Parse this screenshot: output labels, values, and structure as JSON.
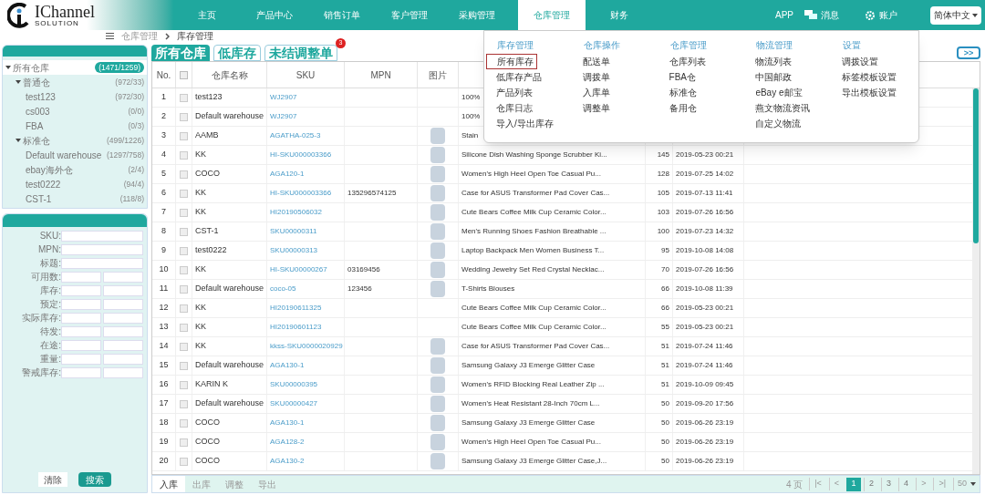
{
  "logo": {
    "title": "IChannel",
    "subtitle": "SOLUTION"
  },
  "nav": {
    "items": [
      {
        "label": "主页",
        "selected": false
      },
      {
        "label": "产品中心",
        "selected": false
      },
      {
        "label": "销售订单",
        "selected": false
      },
      {
        "label": "客户管理",
        "selected": false
      },
      {
        "label": "采购管理",
        "selected": false
      },
      {
        "label": "仓库管理",
        "selected": true
      },
      {
        "label": "财务",
        "selected": false
      }
    ],
    "app": "APP",
    "messages": "消息",
    "account": "账户",
    "language": "简体中文"
  },
  "mega_menu": [
    {
      "heading": "库存管理",
      "items": [
        {
          "label": "所有库存",
          "selected": true
        },
        {
          "label": "低库存产品",
          "selected": false
        },
        {
          "label": "产品列表",
          "selected": false
        },
        {
          "label": "仓库日志",
          "selected": false
        },
        {
          "label": "导入/导出库存",
          "selected": false
        }
      ]
    },
    {
      "heading": "仓库操作",
      "items": [
        {
          "label": "配送单",
          "selected": false
        },
        {
          "label": "调拨单",
          "selected": false
        },
        {
          "label": "入库单",
          "selected": false
        },
        {
          "label": "调整单",
          "selected": false
        }
      ]
    },
    {
      "heading": "仓库管理",
      "items": [
        {
          "label": "仓库列表",
          "selected": false
        },
        {
          "label": "FBA仓",
          "selected": false
        },
        {
          "label": "标准仓",
          "selected": false
        },
        {
          "label": "备用仓",
          "selected": false
        }
      ]
    },
    {
      "heading": "物流管理",
      "items": [
        {
          "label": "物流列表",
          "selected": false
        },
        {
          "label": "中国邮政",
          "selected": false
        },
        {
          "label": "eBay e邮宝",
          "selected": false
        },
        {
          "label": "燕文物流资讯",
          "selected": false
        },
        {
          "label": "自定义物流",
          "selected": false
        }
      ]
    },
    {
      "heading": "设置",
      "items": [
        {
          "label": "调拨设置",
          "selected": false
        },
        {
          "label": "标签模板设置",
          "selected": false
        },
        {
          "label": "导出模板设置",
          "selected": false
        }
      ]
    }
  ],
  "breadcrumb": [
    "仓库管理",
    "库存管理"
  ],
  "tree": [
    {
      "label": "所有仓库",
      "count": "(1471/1259)",
      "selected": true,
      "expanded": true,
      "children": [
        {
          "label": "普通仓",
          "count": "(972/33)",
          "selected": false,
          "expanded": true,
          "children": [
            {
              "label": "test123",
              "count": "(972/30)",
              "selected": false
            },
            {
              "label": "cs003",
              "count": "(0/0)",
              "selected": false
            },
            {
              "label": "FBA",
              "count": "(0/3)",
              "selected": false
            }
          ]
        },
        {
          "label": "标准仓",
          "count": "(499/1226)",
          "selected": false,
          "expanded": true,
          "children": [
            {
              "label": "Default warehouse",
              "count": "(1297/758)",
              "selected": false
            },
            {
              "label": "ebay海外仓",
              "count": "(2/4)",
              "selected": false
            },
            {
              "label": "test0222",
              "count": "(94/4)",
              "selected": false
            },
            {
              "label": "CST-1",
              "count": "(118/8)",
              "selected": false
            }
          ]
        }
      ]
    }
  ],
  "filters": [
    {
      "label": "SKU:",
      "kind": "single"
    },
    {
      "label": "MPN:",
      "kind": "single"
    },
    {
      "label": "标题:",
      "kind": "single"
    },
    {
      "label": "可用数:",
      "kind": "range"
    },
    {
      "label": "库存:",
      "kind": "range"
    },
    {
      "label": "预定:",
      "kind": "range"
    },
    {
      "label": "实际库存:",
      "kind": "range"
    },
    {
      "label": "待发:",
      "kind": "range"
    },
    {
      "label": "在途:",
      "kind": "range"
    },
    {
      "label": "重量:",
      "kind": "range"
    },
    {
      "label": "警戒库存:",
      "kind": "range"
    }
  ],
  "filter_buttons": [
    "清除",
    "搜索"
  ],
  "tabs": [
    {
      "label": "所有仓库",
      "selected": true
    },
    {
      "label": "低库存",
      "selected": false
    },
    {
      "label": "未结调整单",
      "selected": false,
      "badge": "3"
    }
  ],
  "expand_button": ">>",
  "table": {
    "columns": [
      "No.",
      "仓库名称",
      "SKU",
      "MPN",
      "图片"
    ],
    "all_checked": false,
    "rows": [
      {
        "no": "1",
        "checked": false,
        "warehouse": "test123",
        "sku": "WJ2907",
        "mpn": "",
        "image": false,
        "title": "100%"
      },
      {
        "no": "2",
        "checked": false,
        "warehouse": "Default warehouse",
        "sku": "WJ2907",
        "mpn": "",
        "image": false,
        "title": "100%"
      },
      {
        "no": "3",
        "checked": false,
        "warehouse": "AAMB",
        "sku": "AGATHA-025-3",
        "mpn": "",
        "image": true,
        "title": "Stain"
      },
      {
        "no": "4",
        "checked": false,
        "warehouse": "KK",
        "sku": "HI-SKU000003366",
        "mpn": "",
        "image": true,
        "title": "Silicone Dish Washing Sponge Scrubber Ki...",
        "qty": "145",
        "date": "2019-05-23 00:21"
      },
      {
        "no": "5",
        "checked": false,
        "warehouse": "COCO",
        "sku": "AGA120-1",
        "mpn": "",
        "image": true,
        "title": "Women's High Heel Open Toe Casual Pu...",
        "qty": "128",
        "date": "2019-07-25 14:02"
      },
      {
        "no": "6",
        "checked": false,
        "warehouse": "KK",
        "sku": "HI-SKU000003366",
        "mpn": "135296574125",
        "image": true,
        "title": "Case for ASUS Transformer Pad Cover Cas...",
        "qty": "105",
        "date": "2019-07-13 11:41"
      },
      {
        "no": "7",
        "checked": false,
        "warehouse": "KK",
        "sku": "HI20190506032",
        "mpn": "",
        "image": true,
        "title": "Cute Bears Coffee Milk Cup Ceramic Color...",
        "qty": "103",
        "date": "2019-07-26 16:56"
      },
      {
        "no": "8",
        "checked": false,
        "warehouse": "CST-1",
        "sku": "SKU00000311",
        "mpn": "",
        "image": true,
        "title": "Men's Running Shoes Fashion Breathable ...",
        "qty": "100",
        "date": "2019-07-23 14:32"
      },
      {
        "no": "9",
        "checked": false,
        "warehouse": "test0222",
        "sku": "SKU00000313",
        "mpn": "",
        "image": true,
        "title": "Laptop Backpack Men Women Business T...",
        "qty": "95",
        "date": "2019-10-08 14:08"
      },
      {
        "no": "10",
        "checked": false,
        "warehouse": "KK",
        "sku": "HI-SKU00000267",
        "mpn": "03169456",
        "image": true,
        "title": "Wedding Jewelry Set Red Crystal Necklac...",
        "qty": "70",
        "date": "2019-07-26 16:56"
      },
      {
        "no": "11",
        "checked": false,
        "warehouse": "Default warehouse",
        "sku": "coco-05",
        "mpn": "123456",
        "image": true,
        "title": "T-Shirts Blouses",
        "qty": "66",
        "date": "2019-10-08 11:39"
      },
      {
        "no": "12",
        "checked": false,
        "warehouse": "KK",
        "sku": "HI20190611325",
        "mpn": "",
        "image": false,
        "title": "Cute Bears Coffee Milk Cup Ceramic Color...",
        "qty": "66",
        "date": "2019-05-23 00:21"
      },
      {
        "no": "13",
        "checked": false,
        "warehouse": "KK",
        "sku": "HI20190601123",
        "mpn": "",
        "image": false,
        "title": "Cute Bears Coffee Milk Cup Ceramic Color...",
        "qty": "55",
        "date": "2019-05-23 00:21"
      },
      {
        "no": "14",
        "checked": false,
        "warehouse": "KK",
        "sku": "kkss-SKU0000020929",
        "mpn": "",
        "image": true,
        "title": "Case for ASUS Transformer Pad Cover Cas...",
        "qty": "51",
        "date": "2019-07-24 11:46"
      },
      {
        "no": "15",
        "checked": false,
        "warehouse": "Default warehouse",
        "sku": "AGA130-1",
        "mpn": "",
        "image": true,
        "title": "Samsung Galaxy J3 Emerge Glitter Case",
        "qty": "51",
        "date": "2019-07-24 11:46"
      },
      {
        "no": "16",
        "checked": false,
        "warehouse": "KARIN K",
        "sku": "SKU00000395",
        "mpn": "",
        "image": true,
        "title": "Women's RFID Blocking Real Leather Zip ...",
        "qty": "51",
        "date": "2019-10-09 09:45"
      },
      {
        "no": "17",
        "checked": false,
        "warehouse": "Default warehouse",
        "sku": "SKU00000427",
        "mpn": "",
        "image": true,
        "title": "Women's Heat Resistant 28-Inch 70cm L...",
        "qty": "50",
        "date": "2019-09-20 17:56"
      },
      {
        "no": "18",
        "checked": false,
        "warehouse": "COCO",
        "sku": "AGA130-1",
        "mpn": "",
        "image": true,
        "title": "Samsung Galaxy J3 Emerge Glitter Case",
        "qty": "50",
        "date": "2019-06-26 23:19"
      },
      {
        "no": "19",
        "checked": false,
        "warehouse": "COCO",
        "sku": "AGA128-2",
        "mpn": "",
        "image": true,
        "title": "Women's High Heel Open Toe Casual Pu...",
        "qty": "50",
        "date": "2019-06-26 23:19"
      },
      {
        "no": "20",
        "checked": false,
        "warehouse": "COCO",
        "sku": "AGA130-2",
        "mpn": "",
        "image": true,
        "title": "Samsung Galaxy J3 Emerge Glitter Case,J...",
        "qty": "50",
        "date": "2019-06-26 23:19"
      }
    ]
  },
  "actions": [
    "入库",
    "出库",
    "调整",
    "导出"
  ],
  "pagination": {
    "total": "4 页",
    "first": "|<",
    "prev": "<",
    "pages": [
      {
        "label": "1",
        "selected": true
      },
      {
        "label": "2",
        "selected": false
      },
      {
        "label": "3",
        "selected": false
      },
      {
        "label": "4",
        "selected": false
      }
    ],
    "next": ">",
    "last": ">|",
    "page_size": "50"
  }
}
